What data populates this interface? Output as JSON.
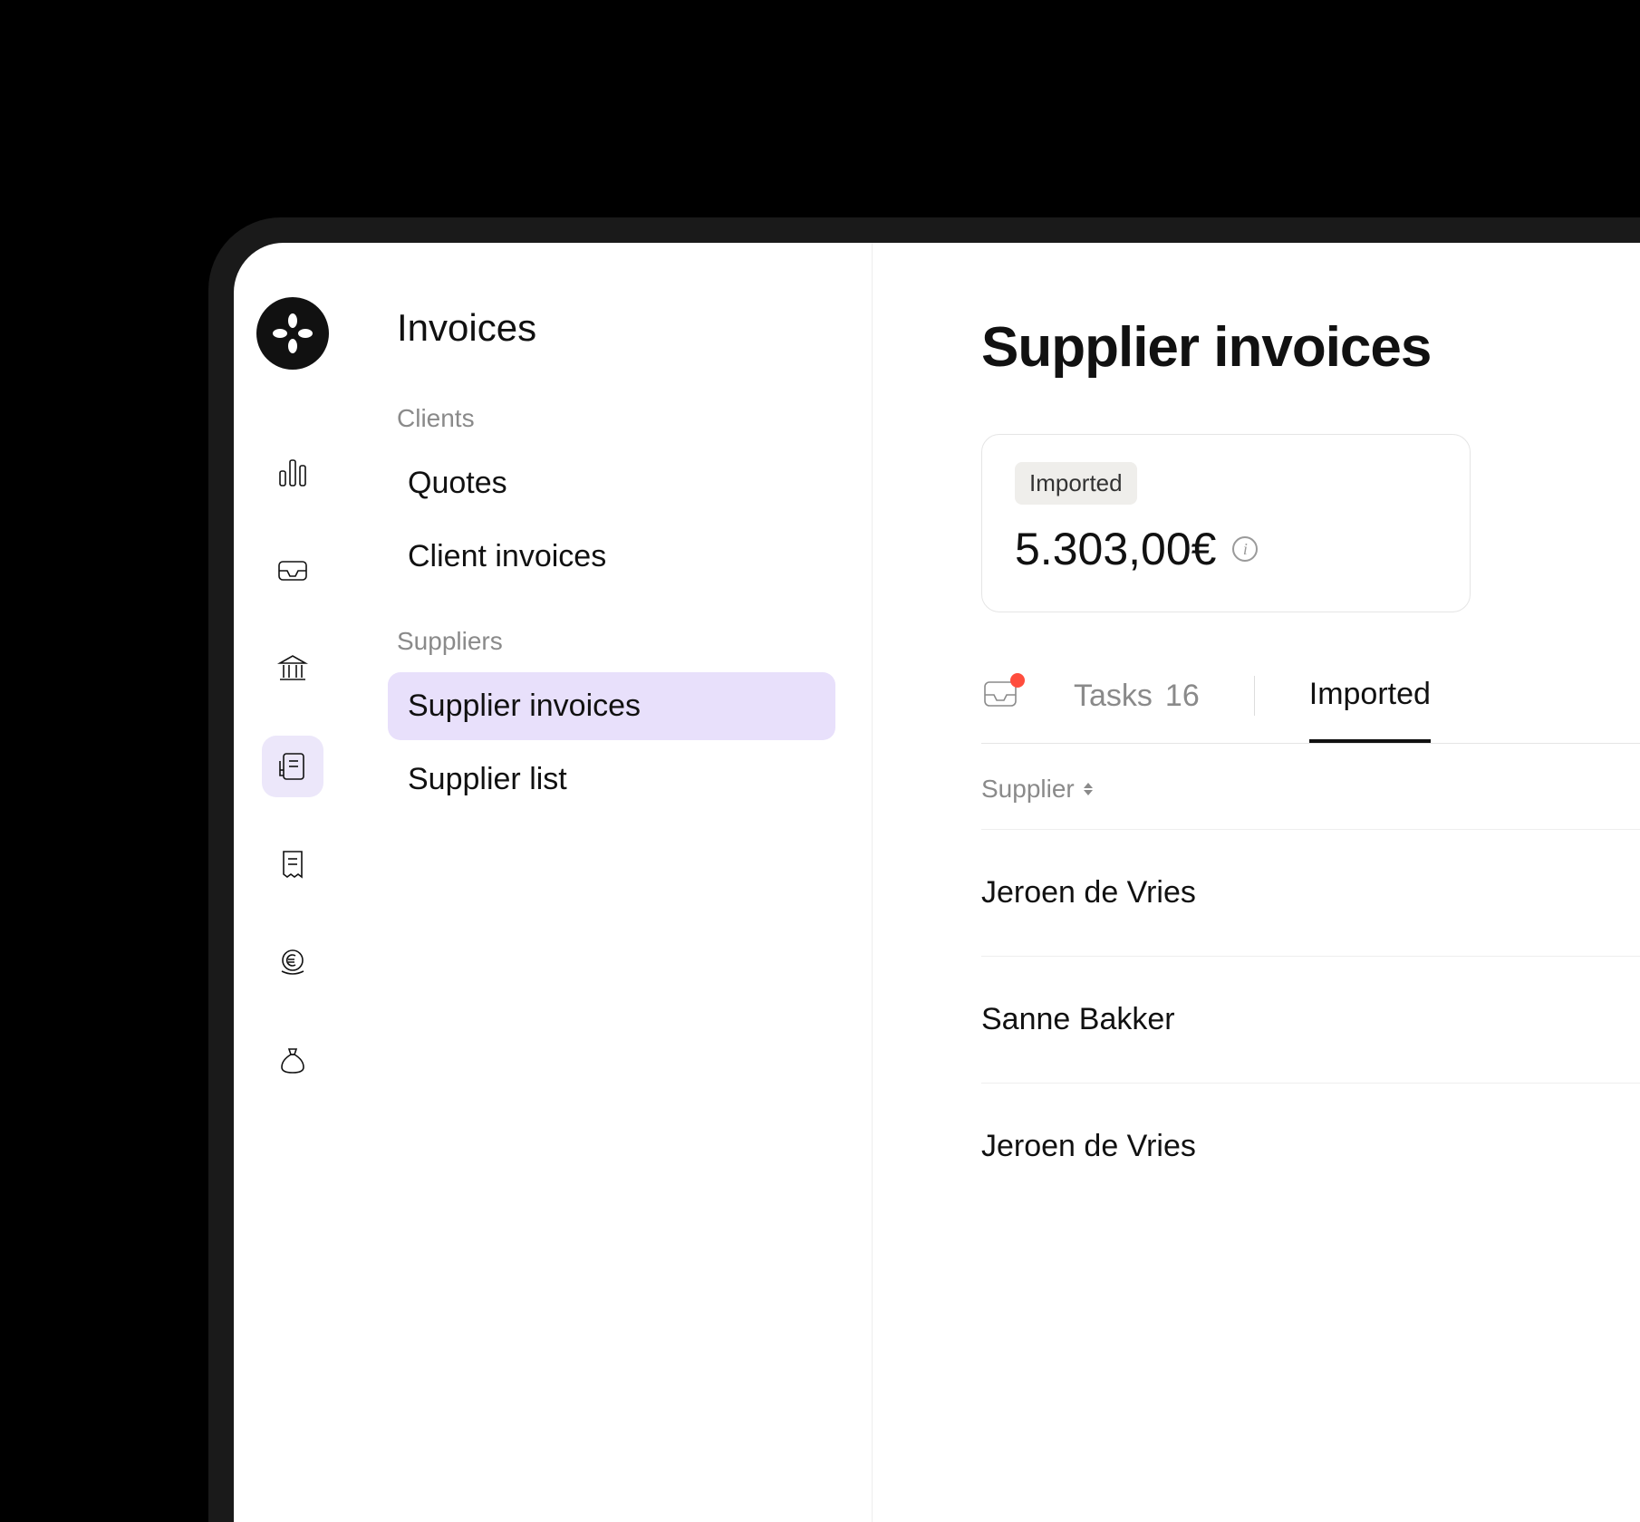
{
  "subnav": {
    "title": "Invoices",
    "groups": [
      {
        "label": "Clients",
        "items": [
          {
            "label": "Quotes",
            "active": false
          },
          {
            "label": "Client invoices",
            "active": false
          }
        ]
      },
      {
        "label": "Suppliers",
        "items": [
          {
            "label": "Supplier invoices",
            "active": true
          },
          {
            "label": "Supplier list",
            "active": false
          }
        ]
      }
    ]
  },
  "page": {
    "title": "Supplier invoices"
  },
  "summary": {
    "badge": "Imported",
    "value": "5.303,00€"
  },
  "tabs": {
    "tasks_label": "Tasks",
    "tasks_count": "16",
    "imported_label": "Imported"
  },
  "table": {
    "column_supplier": "Supplier",
    "rows": [
      {
        "supplier": "Jeroen de Vries"
      },
      {
        "supplier": "Sanne Bakker"
      },
      {
        "supplier": "Jeroen de Vries"
      }
    ]
  }
}
